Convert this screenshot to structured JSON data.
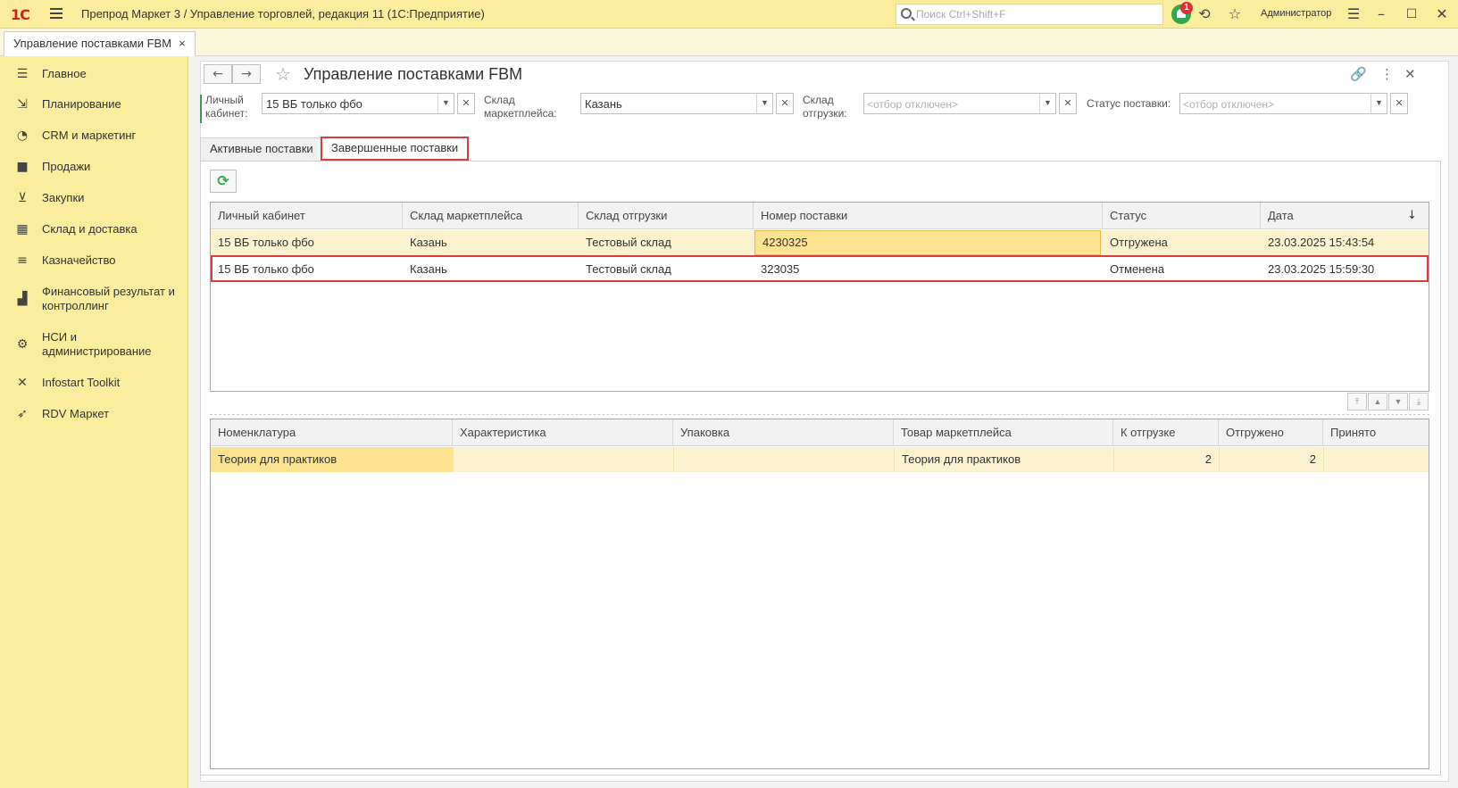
{
  "app": {
    "logo": "1С",
    "title": "Препрод Маркет 3 / Управление торговлей, редакция 11  (1С:Предприятие)",
    "search_placeholder": "Поиск Ctrl+Shift+F",
    "notifications_count": "1",
    "username": "Администратор"
  },
  "open_tab": {
    "label": "Управление поставками FBM",
    "close": "×"
  },
  "sidebar": {
    "items": [
      {
        "label": "Главное",
        "icon": "menu-icon"
      },
      {
        "label": "Планирование",
        "icon": "planning-icon"
      },
      {
        "label": "CRM и маркетинг",
        "icon": "pie-icon"
      },
      {
        "label": "Продажи",
        "icon": "bag-icon"
      },
      {
        "label": "Закупки",
        "icon": "cart-icon"
      },
      {
        "label": "Склад и доставка",
        "icon": "warehouse-icon"
      },
      {
        "label": "Казначейство",
        "icon": "coins-icon"
      },
      {
        "label": "Финансовый результат и контроллинг",
        "icon": "chart-icon"
      },
      {
        "label": "НСИ и администрирование",
        "icon": "gear-icon"
      },
      {
        "label": "Infostart Toolkit",
        "icon": "tools-icon"
      },
      {
        "label": "RDV Маркет",
        "icon": "rocket-icon"
      }
    ]
  },
  "form": {
    "title": "Управление поставками FBM",
    "filters": {
      "cabinet": {
        "label": "Личный кабинет:",
        "value": "15 ВБ только фбо"
      },
      "mp_warehouse": {
        "label": "Склад маркетплейса:",
        "value": "Казань"
      },
      "ship_warehouse": {
        "label": "Склад отгрузки:",
        "placeholder": "<отбор отключен>"
      },
      "status": {
        "label": "Статус поставки:",
        "placeholder": "<отбор отключен>"
      }
    },
    "tabs": {
      "active": "Активные поставки",
      "completed": "Завершенные поставки"
    },
    "shipments": {
      "columns": [
        "Личный кабинет",
        "Склад маркетплейса",
        "Склад отгрузки",
        "Номер поставки",
        "Статус",
        "Дата"
      ],
      "sort_indicator": "↓",
      "rows": [
        [
          "15 ВБ только фбо",
          "Казань",
          "Тестовый склад",
          "4230325",
          "Отгружена",
          "23.03.2025 15:43:54"
        ],
        [
          "15 ВБ только фбо",
          "Казань",
          "Тестовый склад",
          "323035",
          "Отменена",
          "23.03.2025 15:59:30"
        ]
      ]
    },
    "items": {
      "columns": [
        "Номенклатура",
        "Характеристика",
        "Упаковка",
        "Товар маркетплейса",
        "К отгрузке",
        "Отгружено",
        "Принято"
      ],
      "rows": [
        [
          "Теория для практиков",
          "",
          "",
          "Теория для практиков",
          "2",
          "2",
          ""
        ]
      ]
    }
  },
  "colors": {
    "accent_yellow": "#fbed9e",
    "highlight_red": "#e03a3a",
    "refresh_green": "#2fa84f"
  }
}
